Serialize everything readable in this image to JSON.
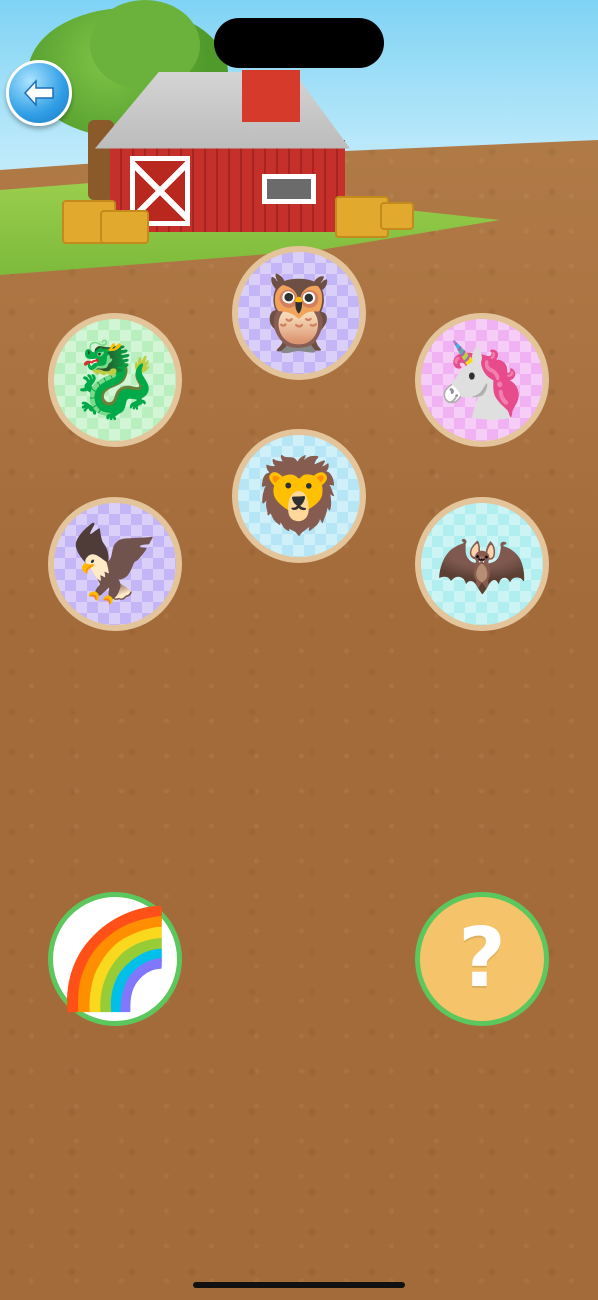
{
  "navigation": {
    "back_icon": "arrow-left-icon"
  },
  "animals": [
    {
      "name": "owl",
      "glyph": "🦉",
      "bg": "purple"
    },
    {
      "name": "dragon",
      "glyph": "🐉",
      "bg": "green"
    },
    {
      "name": "unicorn",
      "glyph": "🦄",
      "bg": "pink"
    },
    {
      "name": "lion",
      "glyph": "🦁",
      "bg": "blue"
    },
    {
      "name": "eagle",
      "glyph": "🦅",
      "bg": "purple"
    },
    {
      "name": "bat",
      "glyph": "🦇",
      "bg": "cyan"
    }
  ],
  "actions": {
    "rainbow_glyph": "🌈",
    "mystery_glyph": "?"
  },
  "colors": {
    "tile_ring": "#e4c49a",
    "action_ring": "#5cc75c",
    "back_button": "#2f9de5"
  }
}
